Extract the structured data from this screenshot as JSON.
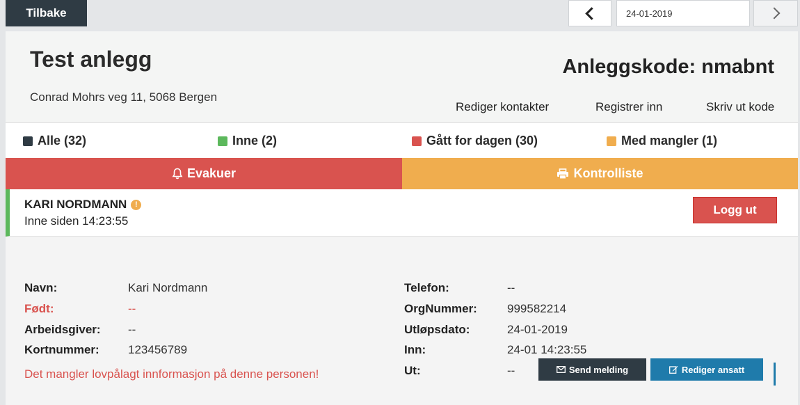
{
  "topbar": {
    "back_label": "Tilbake",
    "date_value": "24-01-2019"
  },
  "site": {
    "title": "Test anlegg",
    "address": "Conrad Mohrs veg 11, 5068 Bergen",
    "code_label": "Anleggskode:",
    "code_value": "nmabnt",
    "links": [
      "Rediger kontakter",
      "Registrer inn",
      "Skriv ut kode"
    ]
  },
  "filters": [
    {
      "label": "Alle (32)",
      "color": "#2f3b44"
    },
    {
      "label": "Inne (2)",
      "color": "#5cb85c"
    },
    {
      "label": "Gått for dagen (30)",
      "color": "#d9534f"
    },
    {
      "label": "Med mangler (1)",
      "color": "#f0ad4e"
    }
  ],
  "actions": {
    "evakuer_label": "Evakuer",
    "kontroll_label": "Kontrolliste"
  },
  "person": {
    "name": "KARI NORDMANN",
    "warn_glyph": "!",
    "status": "Inne siden 14:23:55",
    "logout_label": "Logg ut"
  },
  "details": {
    "left": [
      {
        "label": "Navn:",
        "value": "Kari Nordmann"
      },
      {
        "label": "Født:",
        "value": "--"
      },
      {
        "label": "Arbeidsgiver:",
        "value": "--"
      },
      {
        "label": "Kortnummer:",
        "value": "123456789"
      }
    ],
    "right": [
      {
        "label": "Telefon:",
        "value": "--"
      },
      {
        "label": "OrgNummer:",
        "value": "999582214"
      },
      {
        "label": "Utløpsdato:",
        "value": "24-01-2019"
      },
      {
        "label": "Inn:",
        "value": "24-01 14:23:55"
      },
      {
        "label": "Ut:",
        "value": "--"
      }
    ],
    "missing_message": "Det mangler lovpålagt innformasjon på denne personen!",
    "send_label": "Send melding",
    "edit_label": "Rediger ansatt"
  },
  "colors": {
    "danger": "#d9534f",
    "warning": "#f0ad4e",
    "success": "#5cb85c",
    "dark": "#2f3b44",
    "primary": "#1f7bab"
  }
}
